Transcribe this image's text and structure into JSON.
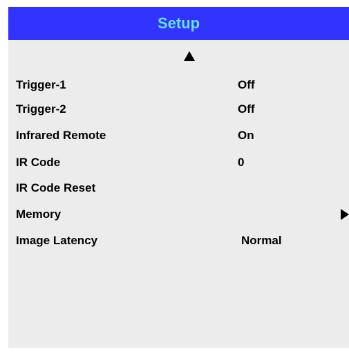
{
  "menu": {
    "title": "Setup",
    "colors": {
      "title_bar": "#3333ff",
      "title_text": "#66e0ff",
      "panel": "#ececec",
      "text": "#000000"
    },
    "scroll_up_icon": "triangle-up-icon",
    "items": [
      {
        "label": "Trigger-1",
        "value": "Off"
      },
      {
        "label": "Trigger-2",
        "value": "Off"
      },
      {
        "label": "Infrared Remote",
        "value": "On"
      },
      {
        "label": "IR Code",
        "value": "0"
      },
      {
        "label": "IR Code Reset",
        "value": ""
      },
      {
        "label": "Memory",
        "value": "",
        "submenu_icon": "triangle-right-icon"
      },
      {
        "label": "Image Latency",
        "value": "Normal"
      }
    ]
  }
}
